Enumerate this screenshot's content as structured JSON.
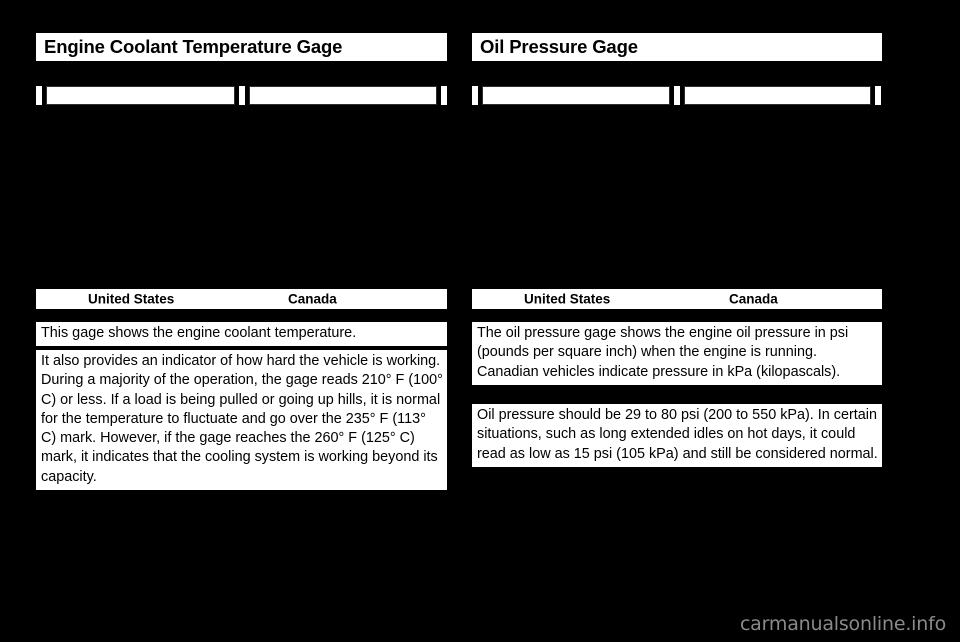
{
  "page": {
    "background_color": "#000000",
    "panel_color": "#ffffff",
    "watermark": "carmanualsonline.info"
  },
  "left_column": {
    "title": "Engine Coolant Temperature Gage",
    "gage_illustration": {
      "name": "engine-coolant-temperature-gage-illustration",
      "panels": 2
    },
    "captions": {
      "united_states": "United States",
      "canada": "Canada"
    },
    "paragraphs": [
      "This gage shows the engine coolant temperature.",
      "It also provides an indicator of how hard the vehicle is working. During a majority of the operation, the gage reads 210° F (100° C) or less. If a load is being pulled or going up hills, it is normal for the temperature to fluctuate and go over the 235° F (113° C) mark. However, if the gage reaches the 260° F (125° C) mark, it indicates that the cooling system is working beyond its capacity."
    ]
  },
  "right_column": {
    "title": "Oil Pressure Gage",
    "gage_illustration": {
      "name": "oil-pressure-gage-illustration",
      "panels": 2
    },
    "captions": {
      "united_states": "United States",
      "canada": "Canada"
    },
    "paragraphs": [
      "The oil pressure gage shows the engine oil pressure in psi (pounds per square inch) when the engine is running. Canadian vehicles indicate pressure in kPa (kilopascals).",
      "Oil pressure should be 29 to 80 psi (200 to 550 kPa). In certain situations, such as long extended idles on hot days, it could read as low as 15 psi (105 kPa) and still be considered normal."
    ]
  }
}
